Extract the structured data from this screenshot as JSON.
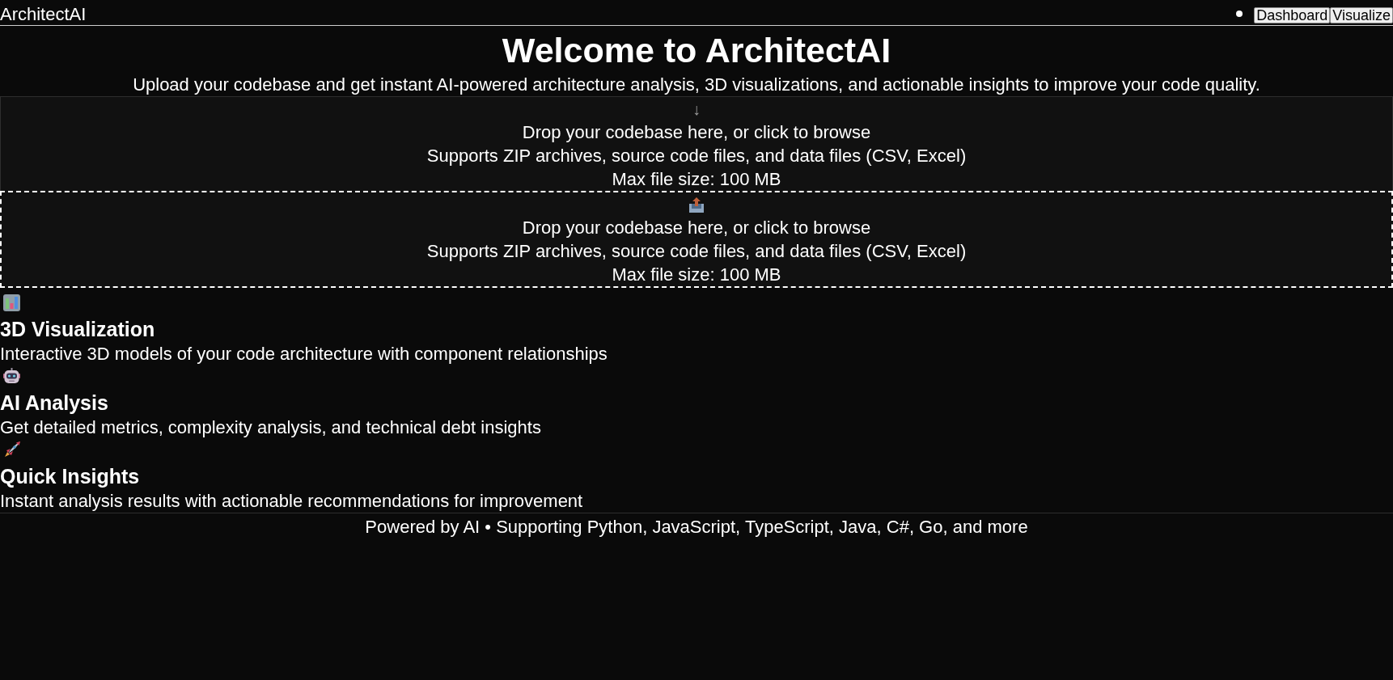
{
  "header": {
    "logo": "ArchitectAI",
    "nav": [
      {
        "label": "Dashboard"
      },
      {
        "label": "Visualize"
      }
    ]
  },
  "hero": {
    "title": "Welcome to ArchitectAI",
    "subtitle": "Upload your codebase and get instant AI-powered architecture analysis, 3D visualizations, and actionable insights to improve your code quality."
  },
  "dropzones": [
    {
      "kind": "plain",
      "icon": "↓",
      "prompt": "Drop your codebase here, or click to browse",
      "formats": "Supports ZIP archives, source code files, and data files (CSV, Excel)",
      "limit": "Max file size: 100 MB"
    },
    {
      "kind": "dashed",
      "prompt": "Drop your codebase here, or click to browse",
      "formats": "Supports ZIP archives, source code files, and data files (CSV, Excel)",
      "limit": "Max file size: 100 MB"
    }
  ],
  "features": [
    {
      "kind": "chart",
      "title": "3D Visualization",
      "description": "Interactive 3D models of your code architecture with component relationships"
    },
    {
      "kind": "robot",
      "title": "AI Analysis",
      "description": "Get detailed metrics, complexity analysis, and technical debt insights"
    },
    {
      "kind": "rocket",
      "title": "Quick Insights",
      "description": "Instant analysis results with actionable recommendations for improvement"
    }
  ],
  "footer": {
    "text": "Powered by AI • Supporting Python, JavaScript, TypeScript, Java, C#, Go, and more"
  }
}
